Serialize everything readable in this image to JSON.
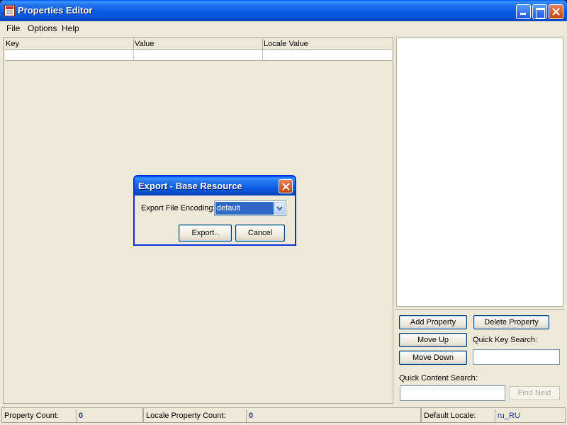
{
  "window": {
    "title": "Properties Editor",
    "icons": {
      "app": "properties-app-icon",
      "minimize": "minimize-icon",
      "maximize": "maximize-icon",
      "close": "close-icon"
    }
  },
  "menubar": {
    "items": [
      {
        "label": "File"
      },
      {
        "label": "Options"
      },
      {
        "label": "Help"
      }
    ]
  },
  "table": {
    "columns": [
      "Key",
      "Value",
      "Locale Value"
    ],
    "rows": [
      [
        "",
        "",
        ""
      ]
    ]
  },
  "right_panel": {
    "add_property": "Add Property",
    "delete_property": "Delete Property",
    "move_up": "Move Up",
    "move_down": "Move Down",
    "quick_key_search_label": "Quick Key Search:",
    "quick_key_search_value": "",
    "quick_content_search_label": "Quick Content Search:",
    "quick_content_search_value": "",
    "find_next": "Find Next"
  },
  "statusbar": {
    "property_count_label": "Property Count:",
    "property_count_value": "0",
    "locale_property_count_label": "Locale Property Count:",
    "locale_property_count_value": "0",
    "default_locale_label": "Default Locale:",
    "default_locale_value": "ru_RU"
  },
  "dialog": {
    "title": "Export - Base Resource",
    "encoding_label": "Export File Encoding:",
    "encoding_value": "default",
    "export_button": "Export..",
    "cancel_button": "Cancel"
  },
  "colors": {
    "titlebar": "#0a5ce3",
    "window_bg": "#ece9d8",
    "selection": "#316ac5",
    "status_value": "#1e2fa0"
  }
}
